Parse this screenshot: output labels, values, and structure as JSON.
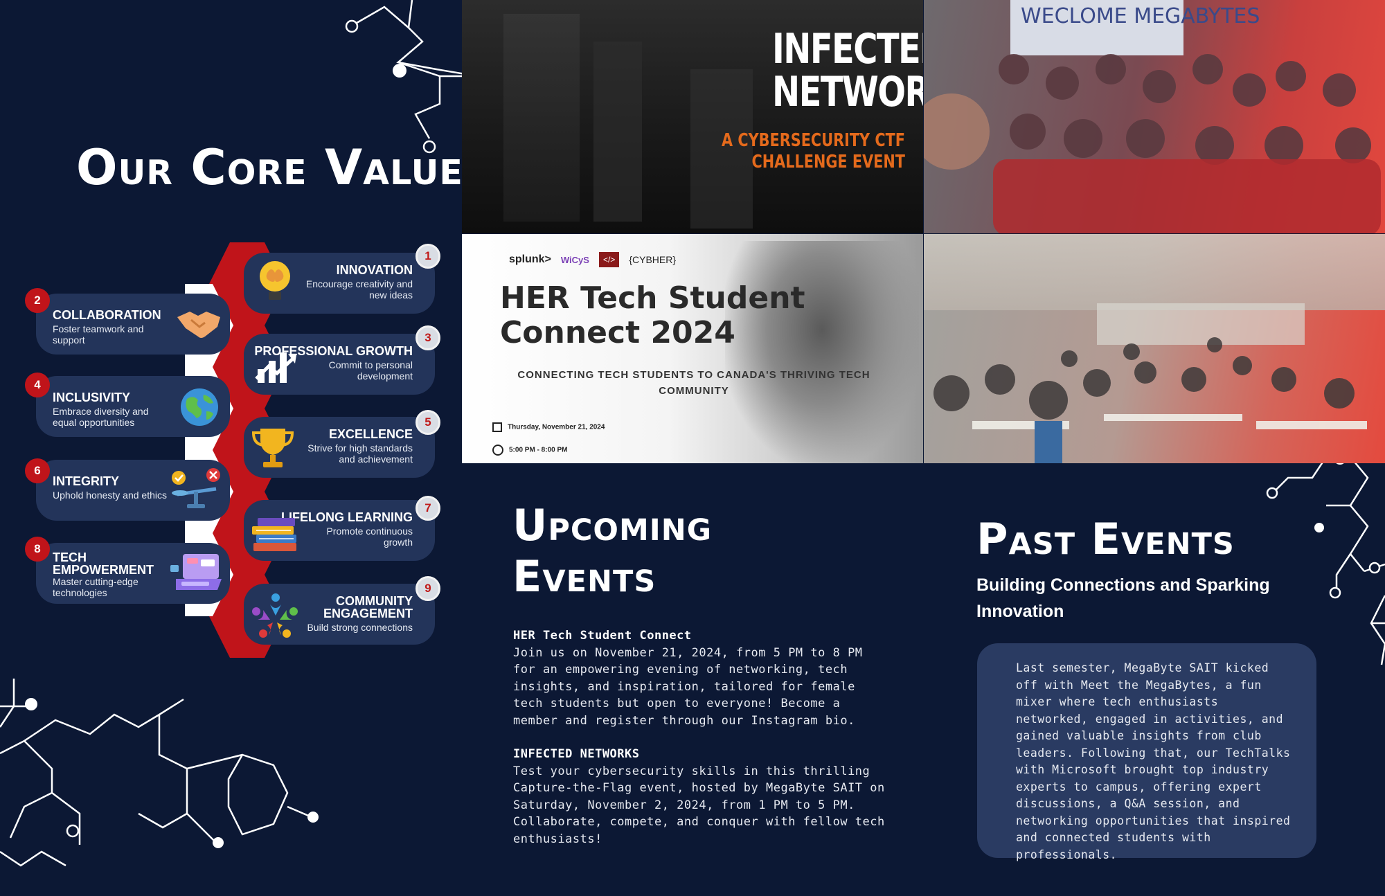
{
  "core_values": {
    "title": "Our Core Values",
    "items": [
      {
        "num": "1",
        "name": "INNOVATION",
        "desc": "Encourage creativity and new ideas",
        "icon": "lightbulb-brain-icon"
      },
      {
        "num": "2",
        "name": "COLLABORATION",
        "desc": "Foster teamwork and support",
        "icon": "handshake-icon"
      },
      {
        "num": "3",
        "name": "PROFESSIONAL GROWTH",
        "desc": "Commit to personal development",
        "icon": "growth-chart-icon"
      },
      {
        "num": "4",
        "name": "INCLUSIVITY",
        "desc": "Embrace diversity and equal opportunities",
        "icon": "globe-icon"
      },
      {
        "num": "5",
        "name": "EXCELLENCE",
        "desc": "Strive for high standards and achievement",
        "icon": "trophy-icon"
      },
      {
        "num": "6",
        "name": "INTEGRITY",
        "desc": "Uphold honesty and ethics",
        "icon": "balance-scale-icon"
      },
      {
        "num": "7",
        "name": "LIFELONG LEARNING",
        "desc": "Promote continuous growth",
        "icon": "books-icon"
      },
      {
        "num": "8",
        "name": "TECH EMPOWERMENT",
        "desc": "Master cutting-edge technologies",
        "icon": "laptop-icon"
      },
      {
        "num": "9",
        "name": "COMMUNITY ENGAGEMENT",
        "desc": "Build strong connections",
        "icon": "community-icon"
      }
    ]
  },
  "photos": {
    "infected": {
      "line1": "INFECTED",
      "line2": "NETWORKS",
      "sub1": "A CYBERSECURITY CTF",
      "sub2": "CHALLENGE EVENT"
    },
    "welcome_board": "WECLOME MEGABYTES",
    "her_poster": {
      "logos": [
        "splunk>",
        "WiCyS",
        "</>",
        "{CYBHER}"
      ],
      "title_line1": "HER Tech Student",
      "title_line2": "Connect 2024",
      "subtitle": "CONNECTING TECH STUDENTS TO CANADA'S THRIVING TECH COMMUNITY",
      "date": "Thursday, November 21, 2024",
      "time": "5:00 PM - 8:00 PM"
    }
  },
  "upcoming": {
    "title_line1": "Upcoming",
    "title_line2": "Events",
    "event1_title": "HER Tech Student Connect",
    "event1_text": "Join us on November 21, 2024, from 5 PM to 8 PM for an empowering evening of networking, tech insights, and inspiration, tailored for female tech students but open to everyone! Become a member and register through our Instagram bio.",
    "event2_title": "INFECTED NETWORKS",
    "event2_text": "Test your cybersecurity skills in this thrilling Capture-the-Flag event, hosted by MegaByte SAIT on Saturday, November 2, 2024, from 1 PM to 5 PM. Collaborate, compete, and conquer with fellow tech enthusiasts!"
  },
  "past": {
    "title": "Past Events",
    "subtitle": "Building Connections and Sparking Innovation",
    "text": "Last semester, MegaByte SAIT kicked off with Meet the MegaBytes, a fun mixer where tech enthusiasts networked, engaged in activities, and gained valuable insights from club leaders. Following that, our TechTalks with Microsoft brought top industry experts to campus, offering expert discussions, a Q&A session, and networking opportunities that inspired and connected students with professionals."
  },
  "colors": {
    "background": "#0c1834",
    "pill": "#23345a",
    "accent_red": "#c0141a",
    "past_box": "#2a3b62"
  }
}
